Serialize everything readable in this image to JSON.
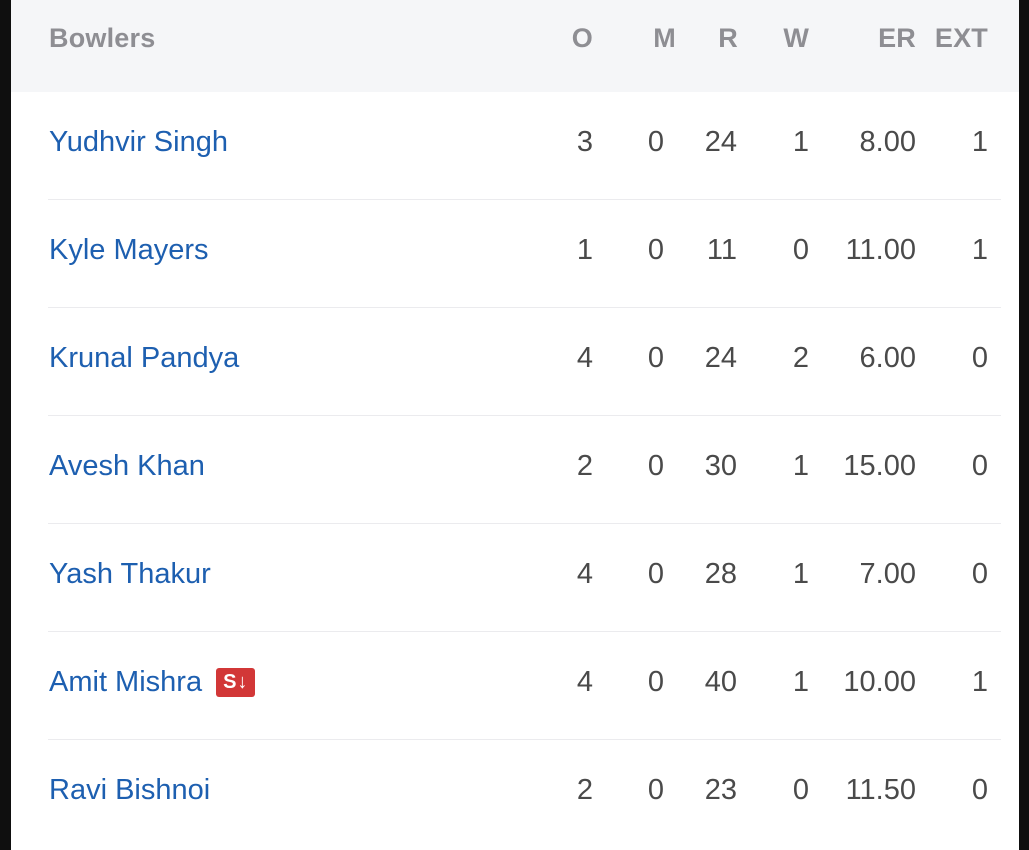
{
  "table": {
    "headers": {
      "name": "Bowlers",
      "overs": "O",
      "maidens": "M",
      "runs": "R",
      "wickets": "W",
      "economy": "ER",
      "extras": "EXT"
    },
    "rows": [
      {
        "name": "Yudhvir Singh",
        "o": "3",
        "m": "0",
        "r": "24",
        "w": "1",
        "er": "8.00",
        "ext": "1",
        "badge": ""
      },
      {
        "name": "Kyle Mayers",
        "o": "1",
        "m": "0",
        "r": "11",
        "w": "0",
        "er": "11.00",
        "ext": "1",
        "badge": ""
      },
      {
        "name": "Krunal Pandya",
        "o": "4",
        "m": "0",
        "r": "24",
        "w": "2",
        "er": "6.00",
        "ext": "0",
        "badge": ""
      },
      {
        "name": "Avesh Khan",
        "o": "2",
        "m": "0",
        "r": "30",
        "w": "1",
        "er": "15.00",
        "ext": "0",
        "badge": ""
      },
      {
        "name": "Yash Thakur",
        "o": "4",
        "m": "0",
        "r": "28",
        "w": "1",
        "er": "7.00",
        "ext": "0",
        "badge": ""
      },
      {
        "name": "Amit Mishra",
        "o": "4",
        "m": "0",
        "r": "40",
        "w": "1",
        "er": "10.00",
        "ext": "1",
        "badge": "S↓"
      },
      {
        "name": "Ravi Bishnoi",
        "o": "2",
        "m": "0",
        "r": "23",
        "w": "0",
        "er": "11.50",
        "ext": "0",
        "badge": ""
      }
    ]
  },
  "colors": {
    "player_link": "#1d5fb0",
    "header_text": "#8e8e93",
    "header_bg": "#f5f6f8",
    "sub_badge_bg": "#d23737"
  }
}
